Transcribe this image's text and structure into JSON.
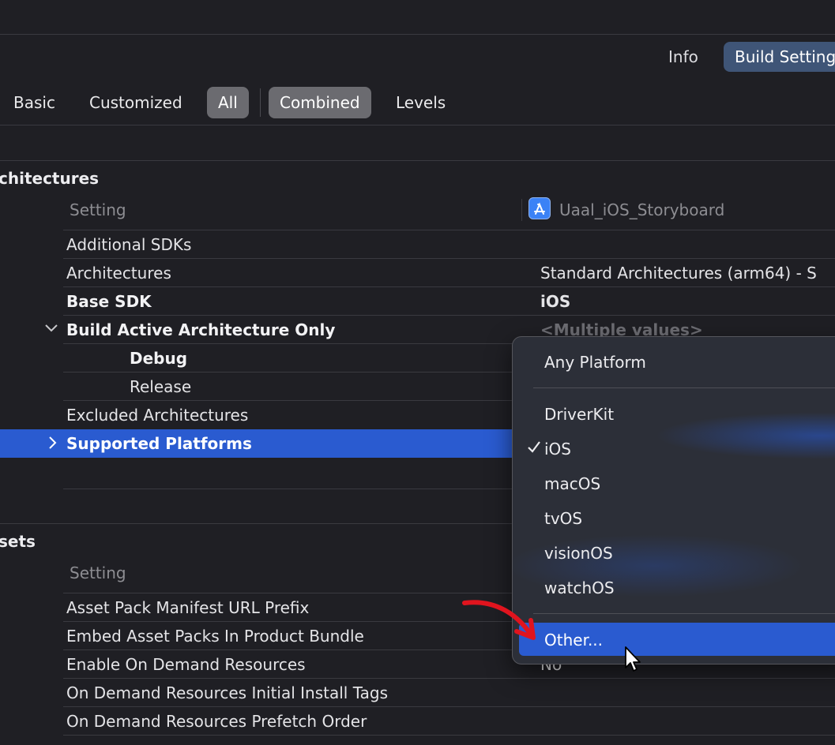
{
  "top_tabs": [
    {
      "label": "Info",
      "selected": false
    },
    {
      "label": "Build Setting",
      "selected": true
    }
  ],
  "filters": {
    "scope": [
      {
        "label": "Basic",
        "selected": false
      },
      {
        "label": "Customized",
        "selected": false
      },
      {
        "label": "All",
        "selected": true
      }
    ],
    "view": [
      {
        "label": "Combined",
        "selected": true
      },
      {
        "label": "Levels",
        "selected": false
      }
    ]
  },
  "architectures": {
    "title": "chitectures",
    "header_setting": "Setting",
    "header_target": "Uaal_iOS_Storyboard",
    "rows": [
      {
        "label": "Additional SDKs",
        "value": ""
      },
      {
        "label": "Architectures",
        "value": "Standard Architectures (arm64)  -  S"
      },
      {
        "label": "Base SDK",
        "value": "iOS"
      },
      {
        "label": "Build Active Architecture Only",
        "value": "<Multiple values>"
      },
      {
        "label": "Debug",
        "value": ""
      },
      {
        "label": "Release",
        "value": ""
      },
      {
        "label": "Excluded Architectures",
        "value": ""
      },
      {
        "label": "Supported Platforms",
        "value": ""
      }
    ]
  },
  "assets": {
    "title": "sets",
    "header_setting": "Setting",
    "rows": [
      {
        "label": "Asset Pack Manifest URL Prefix",
        "value": ""
      },
      {
        "label": "Embed Asset Packs In Product Bundle",
        "value": ""
      },
      {
        "label": "Enable On Demand Resources",
        "value": "No"
      },
      {
        "label": "On Demand Resources Initial Install Tags",
        "value": ""
      },
      {
        "label": "On Demand Resources Prefetch Order",
        "value": ""
      }
    ]
  },
  "platform_menu": {
    "items": [
      "Any Platform",
      "DriverKit",
      "iOS",
      "macOS",
      "tvOS",
      "visionOS",
      "watchOS",
      "Other..."
    ],
    "checked": "iOS",
    "highlighted": "Other..."
  },
  "icons": {
    "target": "app-store-icon",
    "expand": "chevron-down-icon",
    "collapse": "chevron-right-icon",
    "check": "checkmark-icon",
    "cursor": "pointer-cursor-icon",
    "annotation": "red-arrow-icon"
  },
  "colors": {
    "background": "#1f1f24",
    "selection": "#2a5bd0",
    "tab_selected": "#3f5577",
    "annotation": "#e0141e"
  }
}
